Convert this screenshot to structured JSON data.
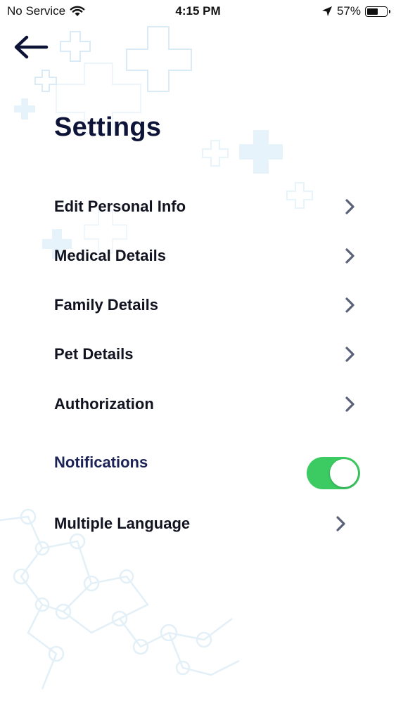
{
  "status_bar": {
    "carrier": "No Service",
    "time": "4:15 PM",
    "battery_percent": "57%",
    "battery_level": 0.57,
    "icons": [
      "wifi-icon",
      "location-arrow-icon",
      "battery-icon"
    ]
  },
  "header": {
    "back_icon": "arrow-left-icon",
    "title": "Settings"
  },
  "menu": {
    "items": [
      {
        "label": "Edit Personal Info",
        "icon": "chevron-right-icon"
      },
      {
        "label": "Medical Details",
        "icon": "chevron-right-icon"
      },
      {
        "label": "Family Details",
        "icon": "chevron-right-icon"
      },
      {
        "label": "Pet Details",
        "icon": "chevron-right-icon"
      },
      {
        "label": "Authorization",
        "icon": "chevron-right-icon"
      },
      {
        "label": "Notifications",
        "toggle": true
      },
      {
        "label": "Multiple Language",
        "icon": "chevron-right-icon"
      }
    ]
  },
  "colors": {
    "title": "#0e1338",
    "toggle_on": "#3ccb62",
    "chevron": "#5a6178",
    "background_pattern": "#d8ecf8"
  }
}
